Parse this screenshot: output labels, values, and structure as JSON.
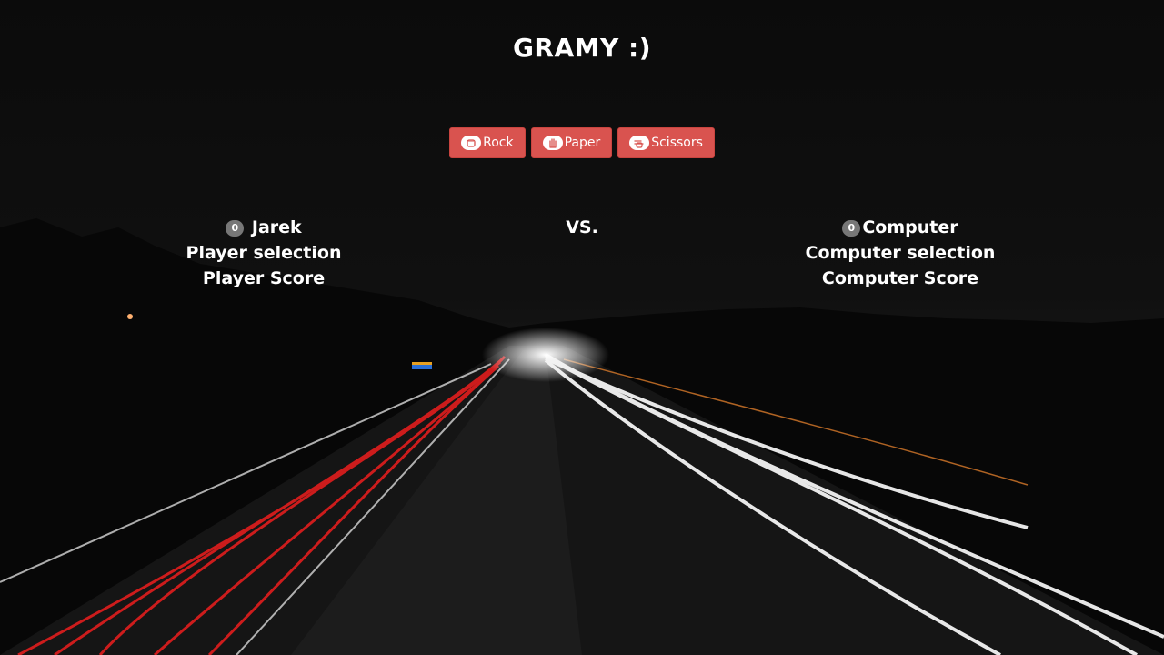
{
  "page": {
    "title": "GRAMY :)"
  },
  "choices": [
    {
      "label": "Rock",
      "icon": "hand-rock-icon"
    },
    {
      "label": "Paper",
      "icon": "hand-paper-icon"
    },
    {
      "label": "Scissors",
      "icon": "hand-scissors-icon"
    }
  ],
  "player": {
    "name": "Jarek",
    "score_badge": "0",
    "selection": "Player selection",
    "score_label": "Player Score"
  },
  "versus": "VS.",
  "computer": {
    "name": "Computer",
    "score_badge": "0",
    "selection": "Computer selection",
    "score_label": "Computer Score"
  },
  "colors": {
    "button_bg": "#d9534f",
    "badge_bg": "#777777",
    "text": "#ffffff",
    "background": "#0d0d0d"
  }
}
